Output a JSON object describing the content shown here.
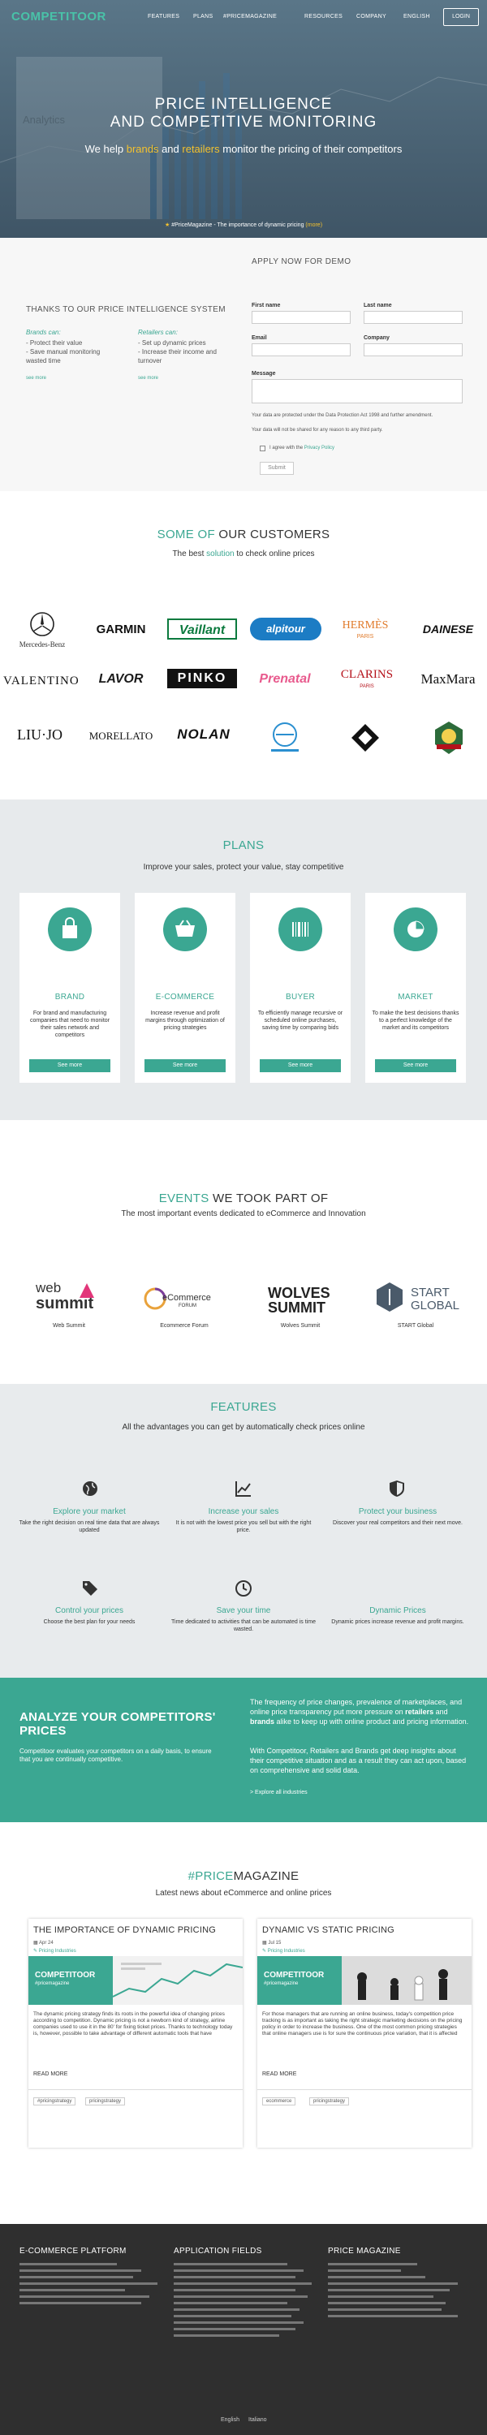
{
  "nav": {
    "logo": "COMPETITOOR",
    "items": [
      "FEATURES",
      "PLANS",
      "#PRICEMAGAZINE",
      "RESOURCES",
      "COMPANY",
      "ENGLISH"
    ],
    "login": "LOGIN"
  },
  "hero": {
    "title_line1": "PRICE INTELLIGENCE",
    "title_line2": "AND COMPETITIVE MONITORING",
    "sub_pre": "We help ",
    "sub_brands": "brands",
    "sub_and": " and ",
    "sub_retailers": "retailers",
    "sub_post": " monitor the pricing of their competitors",
    "pm_pre": "#PriceMagazine - The importance of dynamic pricing ",
    "pm_more": "(more)",
    "analytics_label": "Analytics"
  },
  "demo": {
    "thanks": "THANKS TO OUR PRICE INTELLIGENCE SYSTEM",
    "brands_head": "Brands can:",
    "brands_items": [
      "- Protect their value",
      "- Save manual monitoring",
      "wasted time"
    ],
    "retailers_head": "Retailers can:",
    "retailers_items": [
      "- Set up dynamic prices",
      "- Increase their income and",
      "turnover"
    ],
    "see_more": "see more",
    "form_title": "APPLY NOW FOR DEMO",
    "first_name": "First name",
    "last_name": "Last name",
    "email": "Email",
    "company": "Company",
    "message": "Message",
    "note1": "Your data are protected under the Data Protection Act 1998 and further amendment.",
    "note2": "Your data will not be shared for any reason to any third party.",
    "agree_pre": "I agree with the ",
    "agree_link": "Privacy Policy",
    "submit": "Submit"
  },
  "customers": {
    "title_a": "SOME OF",
    "title_b": " OUR CUSTOMERS",
    "sub_a": "The best ",
    "sub_b": "solution",
    "sub_c": " to check online prices",
    "row1": [
      "Mercedes-Benz",
      "GARMIN",
      "Vaillant",
      "alpitour",
      "HERMÈS",
      "DAINESE"
    ],
    "row2": [
      "VALENTINO",
      "LAVOR",
      "PINKO",
      "Prenatal",
      "CLARINS",
      "MaxMara"
    ],
    "row3": [
      "LIU·JO",
      "MORELLATO",
      "NOLAN",
      "",
      "",
      ""
    ],
    "hermes_sub": "PARIS",
    "clarins_sub": "PARIS",
    "mercedes_label": "Mercedes-Benz"
  },
  "plans": {
    "title": "PLANS",
    "sub": "Improve your sales, protect your value, stay competitive",
    "cards": [
      {
        "title": "BRAND",
        "desc": "For brand and manufacturing companies that need to monitor their sales network and competitors",
        "btn": "See more"
      },
      {
        "title": "E-COMMERCE",
        "desc": "Increase revenue and profit margins through optimization of pricing strategies",
        "btn": "See more"
      },
      {
        "title": "BUYER",
        "desc": "To efficiently manage recursive or scheduled online purchases, saving time by comparing bids",
        "btn": "See more"
      },
      {
        "title": "MARKET",
        "desc": "To make the best decisions thanks to a perfect knowledge of the market and its competitors",
        "btn": "See more"
      }
    ]
  },
  "events": {
    "title_a": "EVENTS",
    "title_b": " WE TOOK PART OF",
    "sub": "The most important events dedicated to eCommerce and Innovation",
    "items": [
      {
        "name": "Web Summit",
        "logo_a": "web",
        "logo_b": "summit"
      },
      {
        "name": "Ecommerce Forum",
        "logo_a": "eCommerce",
        "logo_b": "FORUM"
      },
      {
        "name": "Wolves Summit",
        "logo_a": "WOLVES",
        "logo_b": "SUMMIT"
      },
      {
        "name": "START Global",
        "logo_a": "START",
        "logo_b": "GLOBAL"
      }
    ]
  },
  "features": {
    "title": "FEATURES",
    "sub": "All the advantages you can get by automatically check prices online",
    "items": [
      {
        "title": "Explore your market",
        "desc": "Take the right decision on real time data that are always updated",
        "icon": "globe-icon"
      },
      {
        "title": "Increase your sales",
        "desc": "It is not with the lowest price you sell but with the right price.",
        "icon": "chart-icon"
      },
      {
        "title": "Protect your business",
        "desc": "Discover your real competitors and their next move.",
        "icon": "shield-icon"
      },
      {
        "title": "Control your prices",
        "desc": "Choose the best plan for your needs",
        "icon": "tag-icon"
      },
      {
        "title": "Save your time",
        "desc": "Time dedicated to activities that can be automated is time wasted.",
        "icon": "clock-icon"
      },
      {
        "title": "Dynamic Prices",
        "desc": "Dynamic prices increase revenue and profit margins.",
        "icon": "price-icon"
      }
    ]
  },
  "analyze": {
    "title": "ANALYZE YOUR COMPETITORS' PRICES",
    "desc": "Competitoor evaluates your competitors on a daily basis, to ensure that you are continually competitive.",
    "p1_a": "The frequency of price changes, prevalence of marketplaces, and online price transparency put more pressure on ",
    "p1_retailers": "retailers",
    "p1_b": " and ",
    "p1_brands": "brands",
    "p1_c": " alike to keep up with online product and pricing information.",
    "p2": "With Competitoor, Retailers and Brands get deep insights about their competitive situation and as a result they can act upon, based on comprehensive and solid data.",
    "link": "> Explore all industries"
  },
  "pricemagazine": {
    "title_a": "#PRICE",
    "title_b": "MAGAZINE",
    "sub": "Latest news about eCommerce and online prices",
    "articles": [
      {
        "title": "THE IMPORTANCE OF DYNAMIC PRICING",
        "date": "Apr 24",
        "cat": "Pricing Industries",
        "brand": "COMPETITOOR",
        "brand_sub": "#pricemagazine",
        "excerpt": "The dynamic pricing strategy finds its roots in the powerful idea of changing prices according to competition. Dynamic pricing is not a newborn kind of strategy, airline companies used to use it in the 80' for fixing ticket prices. Thanks to technology today is, however, possible to take advantage of different automatic tools that have",
        "more": "READ MORE",
        "tags": [
          "#pricingstrategy",
          "pricingstrategy"
        ]
      },
      {
        "title": "DYNAMIC VS STATIC PRICING",
        "date": "Jul 15",
        "cat": "Pricing Industries",
        "brand": "COMPETITOOR",
        "brand_sub": "#pricemagazine",
        "excerpt": "For those managers that are running an online business, today's competition price tracking is as important as taking the right strategic marketing decisions on the pricing policy in order to increase the business. One of the most common pricing strategies that online managers use is for sure the continuous price variation, that it is affected",
        "more": "READ MORE",
        "tags": [
          "ecommerce",
          "pricingstrategy"
        ]
      }
    ]
  },
  "footer": {
    "col1": "E-COMMERCE PLATFORM",
    "col2": "APPLICATION FIELDS",
    "col3": "PRICE MAGAZINE",
    "lang_en": "English",
    "lang_it": "Italiano"
  },
  "colors": {
    "accent": "#3ba792",
    "accent_logo": "#49c2a8",
    "highlight": "#f3c12e",
    "footer_bg": "#2f2f2f"
  }
}
